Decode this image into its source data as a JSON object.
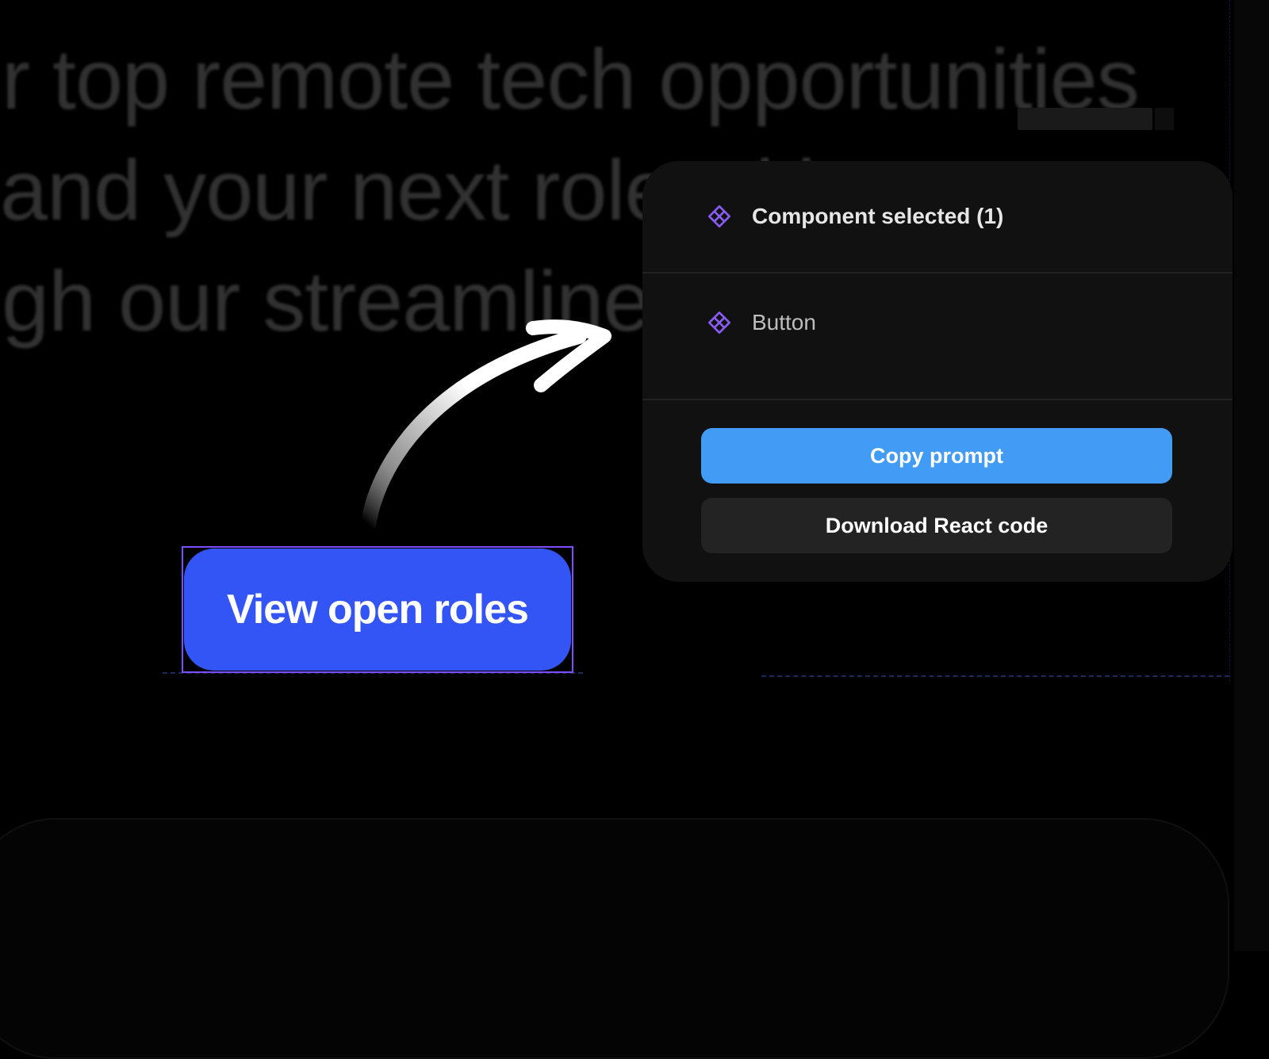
{
  "background": {
    "headline_lines": [
      "r top remote tech opportunities",
      "and your next role with",
      "gh our streamlined"
    ]
  },
  "selected_button": {
    "label": "View open roles",
    "color": "#3355f6",
    "selection_color": "#7c4dff"
  },
  "panel": {
    "selection_status": "Component selected (1)",
    "selection_icon": "component-icon",
    "component_name": "Button",
    "component_icon": "component-icon",
    "copy_prompt_label": "Copy prompt",
    "download_label": "Download React code",
    "accent_color": "#429cf6",
    "icon_color": "#8b5cf6"
  }
}
